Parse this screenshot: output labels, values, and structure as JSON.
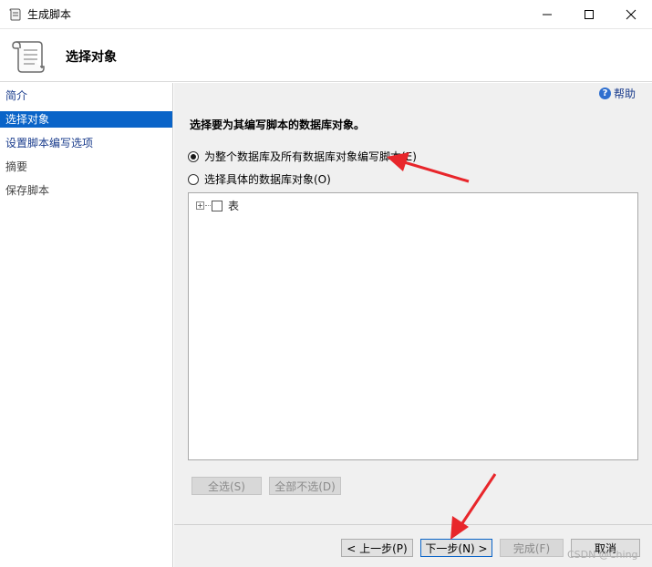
{
  "window": {
    "title": "生成脚本",
    "minimize_icon": "minimize-icon",
    "maximize_icon": "maximize-icon",
    "close_icon": "close-icon"
  },
  "header": {
    "title": "选择对象",
    "icon": "script-scroll-icon"
  },
  "nav": {
    "items": [
      {
        "label": "简介",
        "state": "link"
      },
      {
        "label": "选择对象",
        "state": "selected"
      },
      {
        "label": "设置脚本编写选项",
        "state": "link"
      },
      {
        "label": "摘要",
        "state": "disabled"
      },
      {
        "label": "保存脚本",
        "state": "disabled"
      }
    ]
  },
  "content": {
    "help_label": "帮助",
    "instruction": "选择要为其编写脚本的数据库对象。",
    "radio_all": {
      "label": "为整个数据库及所有数据库对象编写脚本(E)",
      "checked": true
    },
    "radio_specific": {
      "label": "选择具体的数据库对象(O)",
      "checked": false
    },
    "tree": {
      "items": [
        {
          "label": "表",
          "expander": "⊞",
          "checked": false
        }
      ]
    },
    "select_all_label": "全选(S)",
    "deselect_all_label": "全部不选(D)"
  },
  "footer": {
    "prev_label": "< 上一步(P)",
    "next_label": "下一步(N) >",
    "finish_label": "完成(F)",
    "cancel_label": "取消"
  },
  "watermark": "CSDN @Ching",
  "colors": {
    "accent": "#0a64c8",
    "link": "#1a3c8c",
    "annotation_arrow": "#e8262b"
  }
}
